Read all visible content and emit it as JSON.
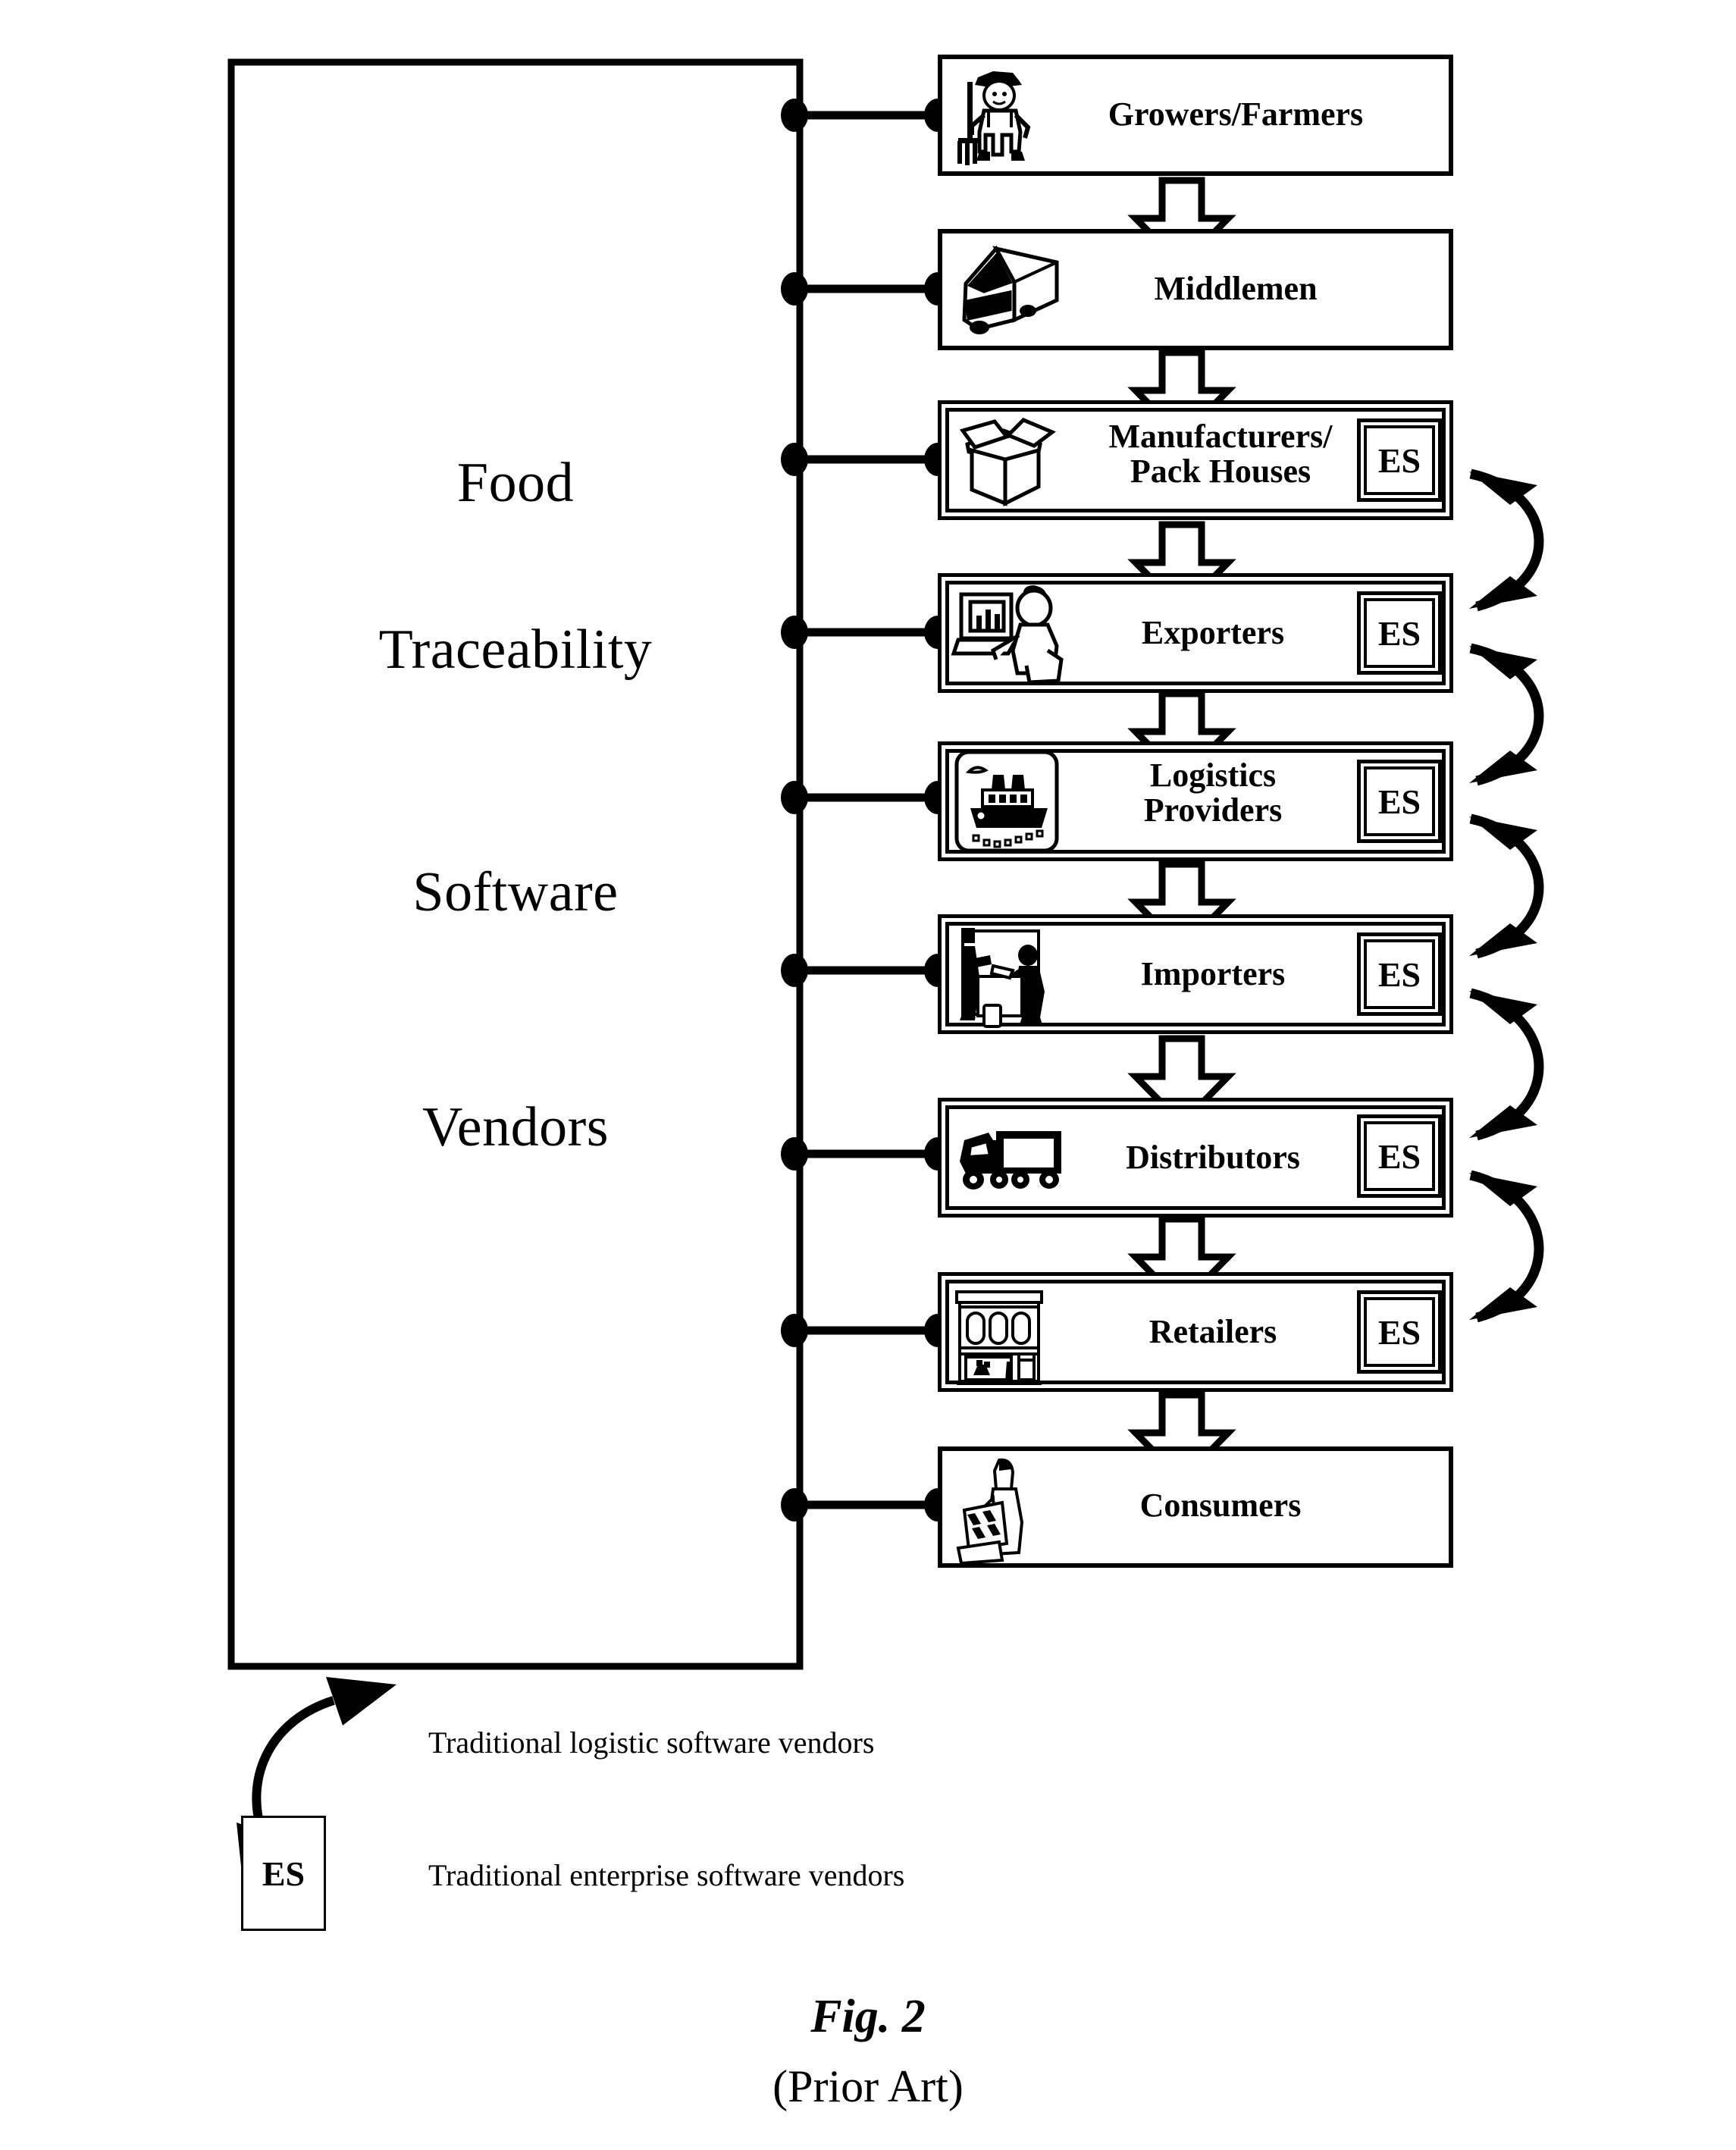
{
  "figure": {
    "caption": "Fig. 2",
    "subcaption": "(Prior Art)"
  },
  "vendor_panel": {
    "lines": [
      "Food",
      "Traceability",
      "Software",
      "Vendors"
    ],
    "full_label": "Food Traceability Software Vendors"
  },
  "supply_chain": {
    "stages": [
      {
        "label": "Growers/Farmers",
        "icon": "farmer-icon",
        "has_es": false,
        "es_label": ""
      },
      {
        "label": "Middlemen",
        "icon": "delivery-truck-icon",
        "has_es": false,
        "es_label": ""
      },
      {
        "label": "Manufacturers/\nPack Houses",
        "icon": "open-box-icon",
        "has_es": true,
        "es_label": "ES"
      },
      {
        "label": "Exporters",
        "icon": "office-worker-computer-icon",
        "has_es": true,
        "es_label": "ES"
      },
      {
        "label": "Logistics\nProviders",
        "icon": "cargo-ship-icon",
        "has_es": true,
        "es_label": "ES"
      },
      {
        "label": "Importers",
        "icon": "warehouse-workers-icon",
        "has_es": true,
        "es_label": "ES"
      },
      {
        "label": "Distributors",
        "icon": "semi-truck-icon",
        "has_es": true,
        "es_label": "ES"
      },
      {
        "label": "Retailers",
        "icon": "storefront-icon",
        "has_es": true,
        "es_label": "ES"
      },
      {
        "label": "Consumers",
        "icon": "shopper-icon",
        "has_es": false,
        "es_label": ""
      }
    ]
  },
  "legend": {
    "items": [
      {
        "symbol": "curved-double-arrow",
        "text": "Traditional logistic software vendors"
      },
      {
        "symbol": "ES",
        "text": "Traditional enterprise software vendors"
      }
    ]
  },
  "colors": {
    "line": "#000000",
    "background": "#ffffff"
  }
}
